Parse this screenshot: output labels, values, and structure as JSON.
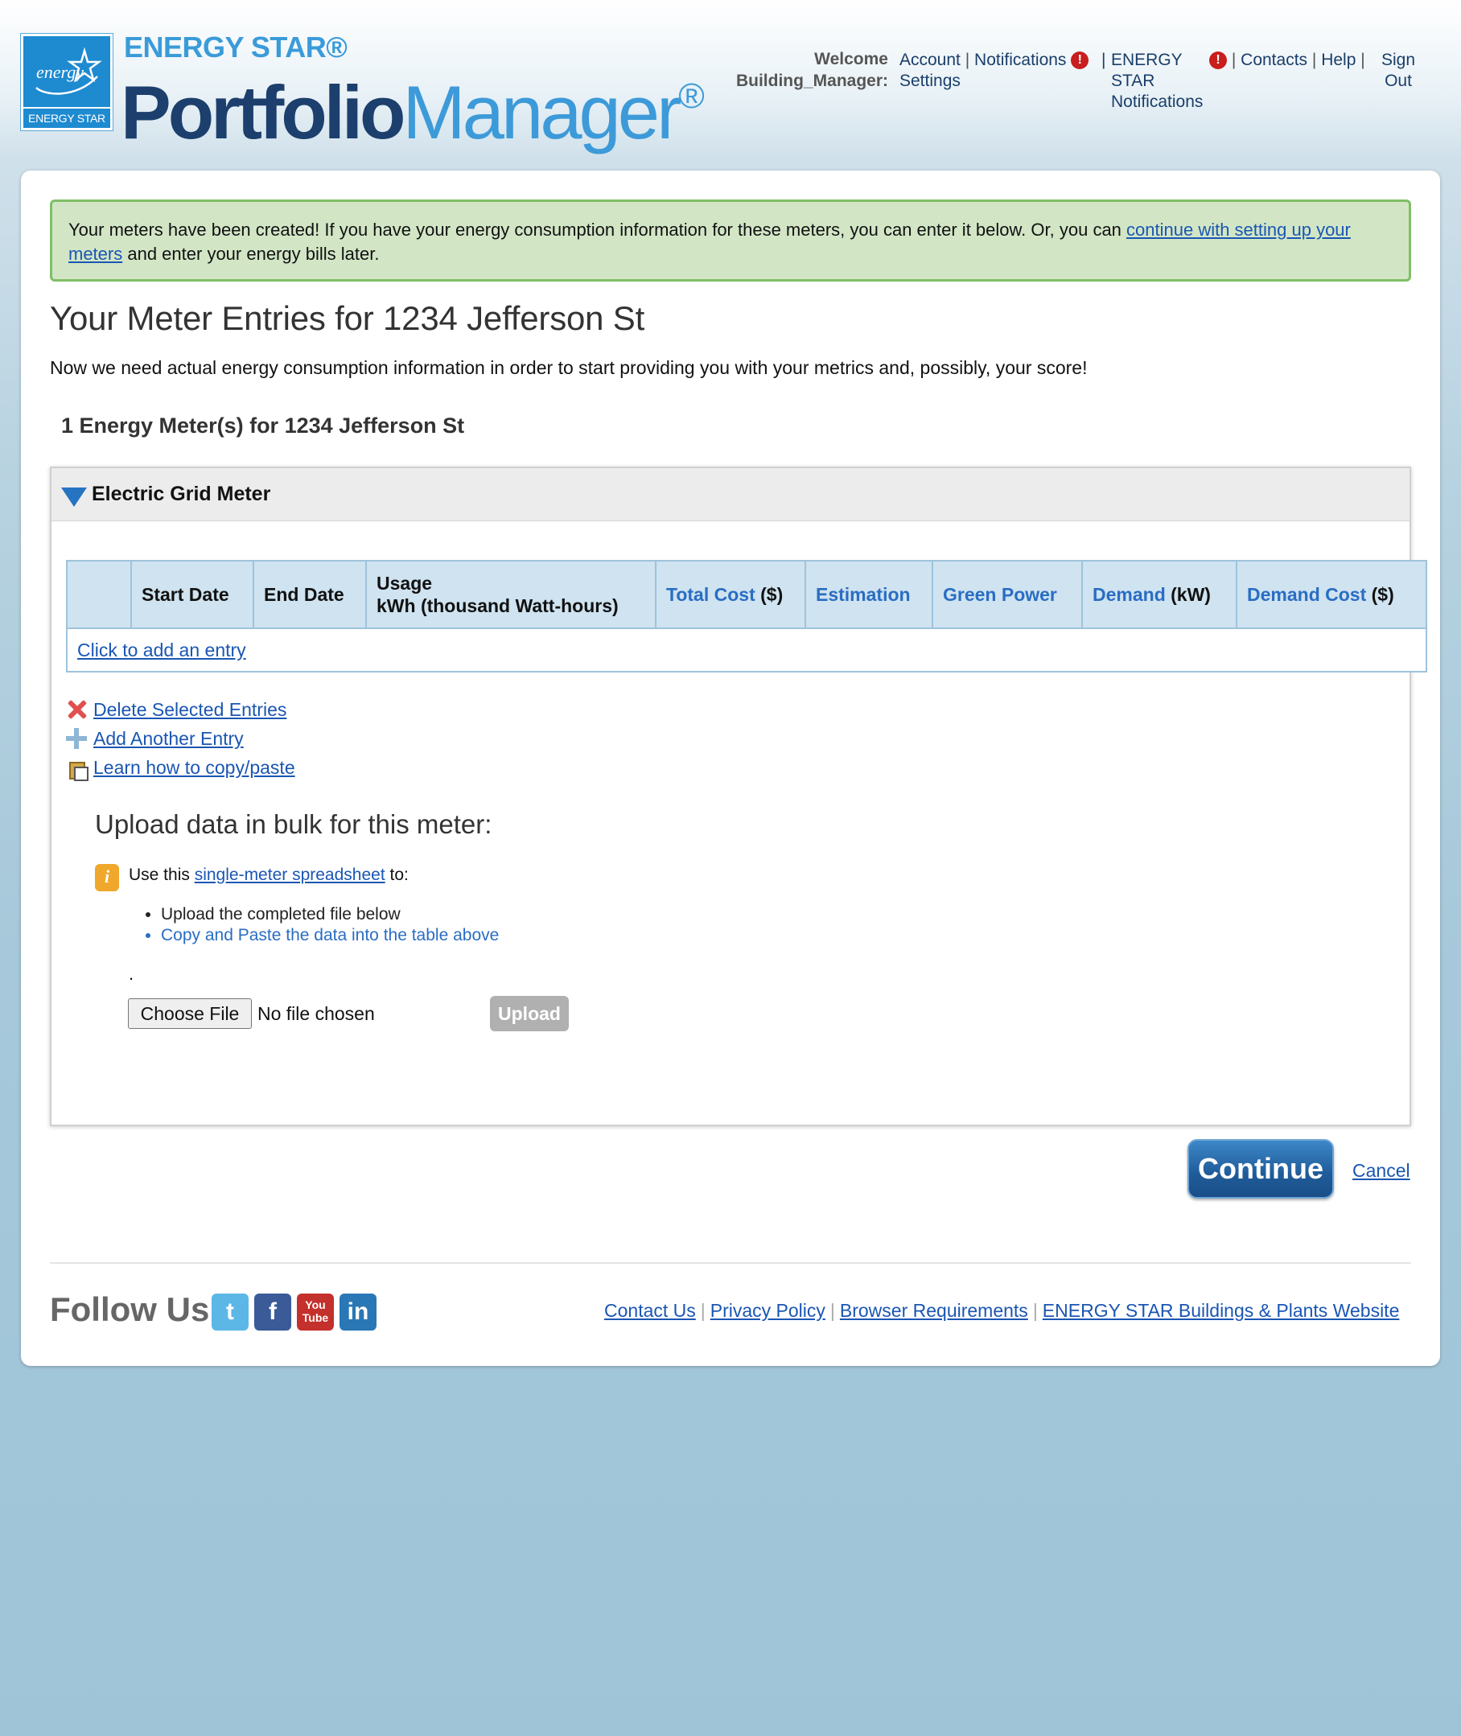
{
  "header": {
    "brand_top": "ENERGY STAR®",
    "brand_portfolio": "Portfolio",
    "brand_manager": "Manager",
    "brand_reg": "®",
    "logo_script": "energy",
    "logo_label": "ENERGY STAR",
    "welcome_text": "Welcome Building_Manager:",
    "nav": {
      "account": "Account",
      "notifications": "Notifications",
      "settings": "Settings",
      "energy_star_notifications": "ENERGY STAR Notifications",
      "contacts": "Contacts",
      "help": "Help",
      "sign_out": "Sign Out",
      "separator": "|",
      "alert_glyph": "!"
    }
  },
  "success_message": {
    "text_before": "Your meters have been created! If you have your energy consumption information for these meters, you can enter it below. Or, you can ",
    "link": "continue with setting up your meters",
    "text_after": " and enter your energy bills later."
  },
  "page_title": "Your Meter Entries for 1234 Jefferson St",
  "intro": "Now we need actual energy consumption information in order to start providing you with your metrics and, possibly, your score!",
  "meter_count": "1 Energy Meter(s) for 1234 Jefferson St",
  "meter": {
    "title": "Electric Grid Meter",
    "columns": {
      "start_date": "Start Date",
      "end_date": "End Date",
      "usage_line1": "Usage",
      "usage_line2": "kWh (thousand Watt-hours)",
      "total_cost": "Total Cost",
      "total_cost_unit": "($)",
      "estimation": "Estimation",
      "green_power": "Green Power",
      "demand": "Demand",
      "demand_unit": "(kW)",
      "demand_cost": "Demand Cost",
      "demand_cost_unit": "($)"
    },
    "add_entry_link": "Click to add an entry",
    "actions": {
      "delete": "Delete Selected Entries",
      "add_another": "Add Another Entry",
      "learn_copy": "Learn how to copy/paste"
    },
    "bulk": {
      "title": "Upload data in bulk for this meter:",
      "info_prefix": "Use this ",
      "info_link": "single-meter spreadsheet",
      "info_suffix": " to:",
      "bullet1": "Upload the completed file below",
      "bullet2": "Copy and Paste the data into the table above",
      "dot": ".",
      "choose_file": "Choose File",
      "no_file": "No file chosen",
      "upload": "Upload"
    }
  },
  "buttons": {
    "continue": "Continue",
    "cancel": "Cancel"
  },
  "footer": {
    "follow_us": "Follow Us",
    "social": {
      "twitter": "t",
      "facebook": "f",
      "youtube_top": "You",
      "youtube_bottom": "Tube",
      "linkedin": "in"
    },
    "links": {
      "contact": "Contact Us",
      "privacy": "Privacy Policy",
      "browser": "Browser Requirements",
      "buildings": "ENERGY STAR Buildings & Plants Website",
      "separator": "|"
    }
  },
  "colors": {
    "accent_blue": "#2a6dc3",
    "brand_navy": "#1c3f6e",
    "brand_light_blue": "#3d9ad9",
    "success_bg": "#d2e6c6",
    "success_border": "#7fbf66",
    "alert_red": "#c81e1e"
  }
}
